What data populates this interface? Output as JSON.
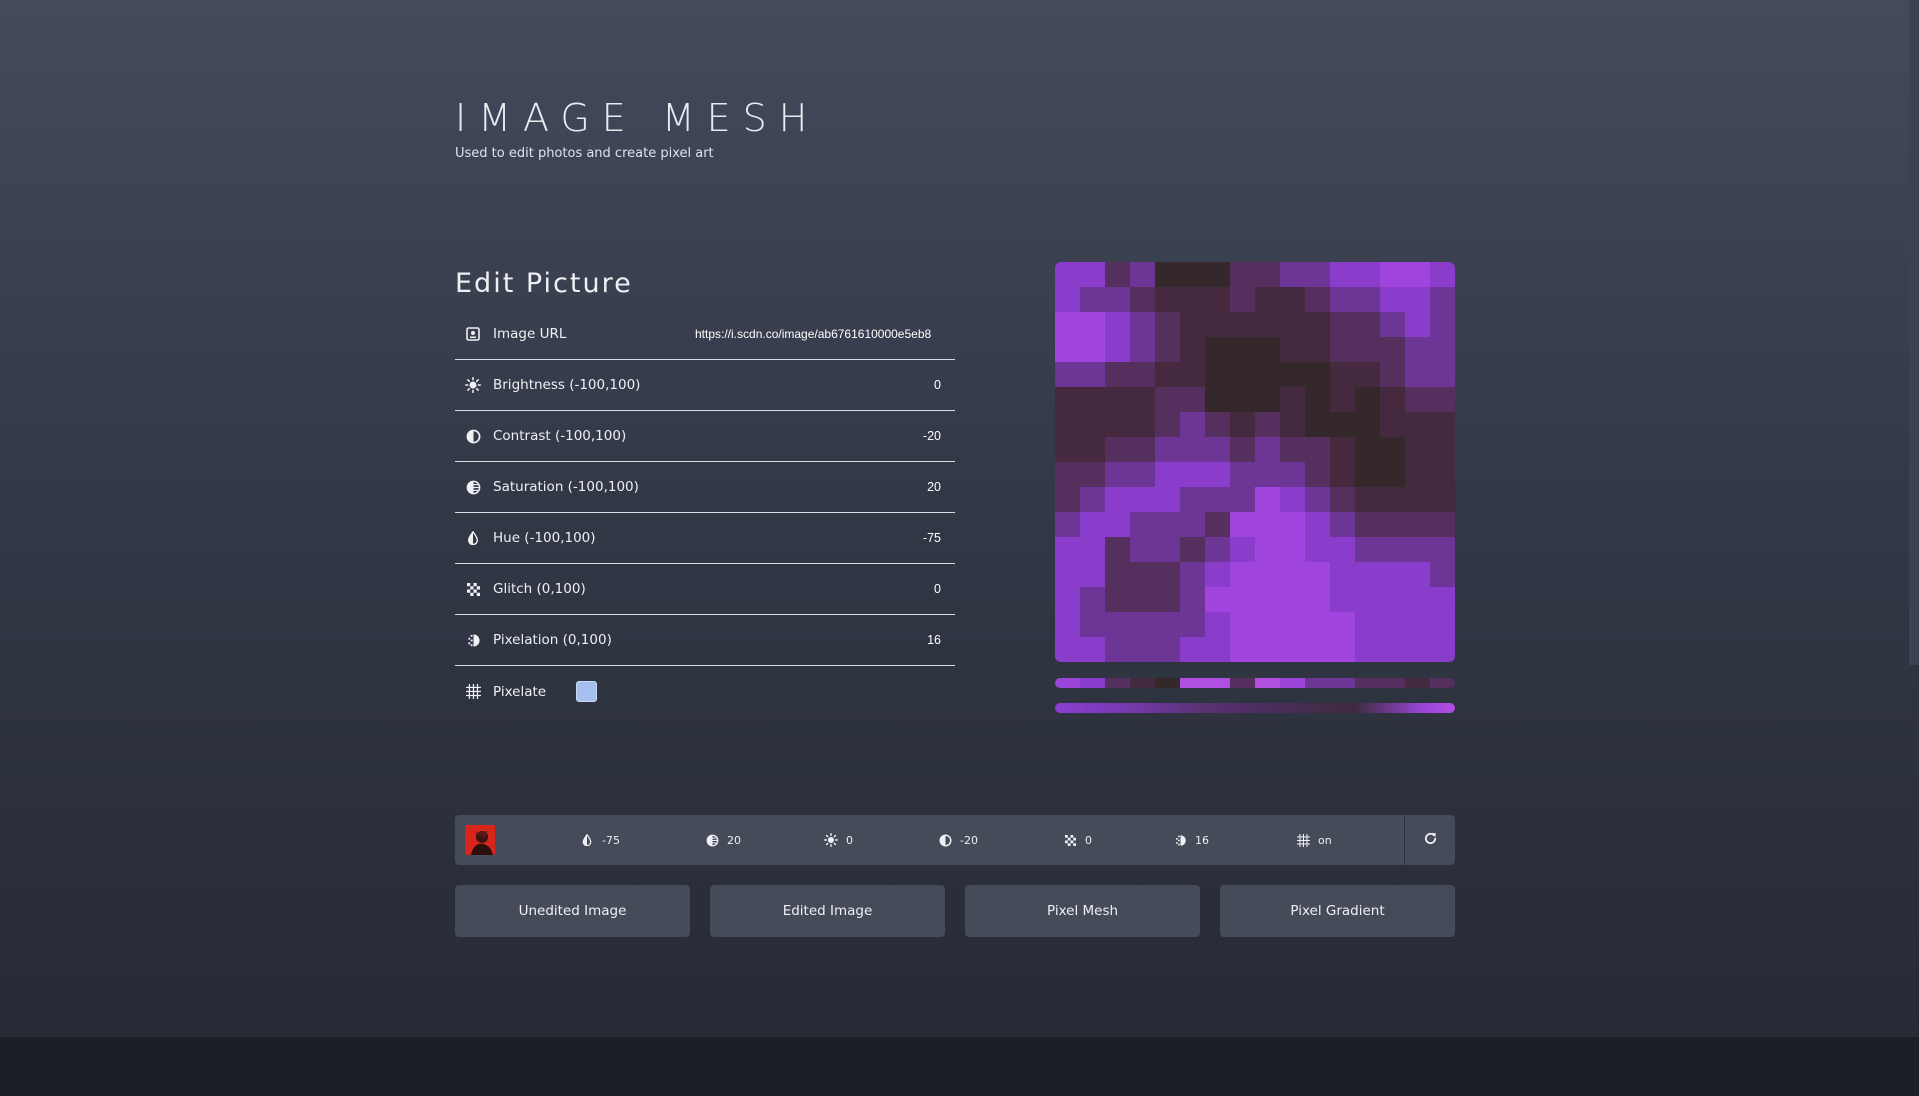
{
  "header": {
    "title": "IMAGE MESH",
    "subtitle": "Used to edit photos and create pixel art"
  },
  "editor": {
    "section_title": "Edit Picture",
    "fields": [
      {
        "label": "Image URL",
        "value": "https://i.scdn.co/image/ab6761610000e5eb8",
        "icon": "image-icon"
      },
      {
        "label": "Brightness (-100,100)",
        "value": "0",
        "icon": "sun-icon"
      },
      {
        "label": "Contrast (-100,100)",
        "value": "-20",
        "icon": "contrast-icon"
      },
      {
        "label": "Saturation (-100,100)",
        "value": "20",
        "icon": "saturation-icon"
      },
      {
        "label": "Hue (-100,100)",
        "value": "-75",
        "icon": "hue-icon"
      },
      {
        "label": "Glitch (0,100)",
        "value": "0",
        "icon": "checker-icon"
      },
      {
        "label": "Pixelation (0,100)",
        "value": "16",
        "icon": "pixelation-icon"
      },
      {
        "label": "Pixelate",
        "value": true,
        "icon": "grid-icon"
      }
    ]
  },
  "summary_bar": {
    "stats": [
      {
        "icon": "hue-icon",
        "value": "-75"
      },
      {
        "icon": "saturation-icon",
        "value": "20"
      },
      {
        "icon": "sun-icon",
        "value": "0"
      },
      {
        "icon": "contrast-icon",
        "value": "-20"
      },
      {
        "icon": "checker-icon",
        "value": "0"
      },
      {
        "icon": "pixelation-icon",
        "value": "16"
      },
      {
        "icon": "grid-icon",
        "value": "on"
      }
    ],
    "refresh_icon": "refresh-icon"
  },
  "buttons": {
    "unedited": "Unedited Image",
    "edited": "Edited Image",
    "mesh": "Pixel Mesh",
    "gradient": "Pixel Gradient"
  },
  "colors": {
    "accent": "#a5c0ee",
    "panel": "#454b59",
    "mesh_palette": [
      "#8a3fd1",
      "#a447e0",
      "#6c3a8f",
      "#4b2d5e",
      "#3a2a3e",
      "#2e2a28",
      "#5a3578",
      "#9b46d8",
      "#b04fe0"
    ]
  }
}
